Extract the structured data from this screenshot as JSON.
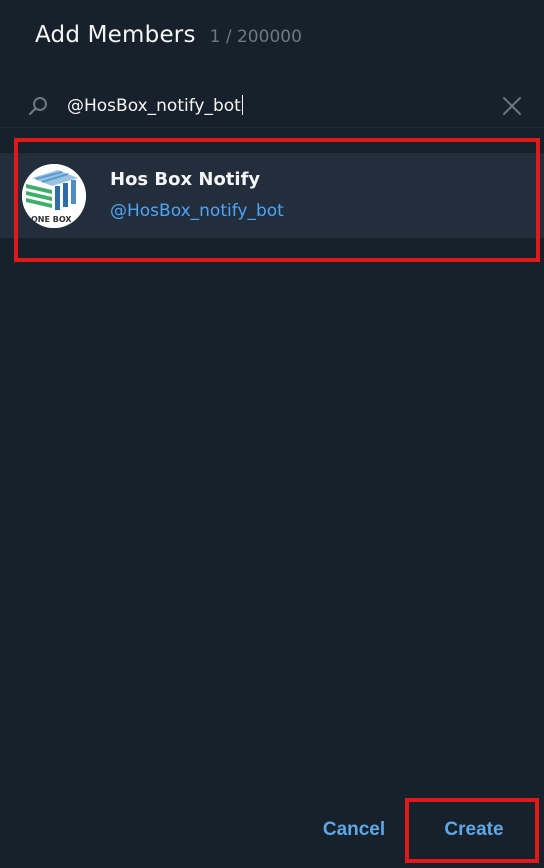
{
  "header": {
    "title": "Add Members",
    "count": "1 / 200000"
  },
  "search": {
    "value": "@HosBox_notify_bot",
    "search_icon": "search-icon",
    "clear_icon": "close-icon"
  },
  "results": [
    {
      "name": "Hos Box Notify",
      "username": "@HosBox_notify_bot",
      "avatar_text": "ONE BOX"
    }
  ],
  "footer": {
    "cancel_label": "Cancel",
    "create_label": "Create"
  },
  "colors": {
    "background": "#17212b",
    "row_selected": "#232e3c",
    "accent": "#4ea4f6",
    "button_text": "#5ea7e6",
    "highlight": "#e0191b"
  }
}
